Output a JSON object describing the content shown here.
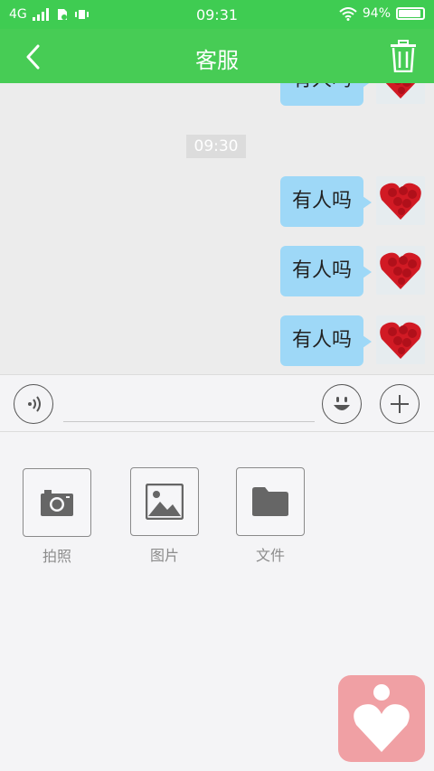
{
  "status_bar": {
    "network": "4G",
    "time": "09:31",
    "battery_percent": "94%",
    "battery_level": 0.94
  },
  "app_bar": {
    "title": "客服"
  },
  "chat": {
    "partial_message": "有人吗",
    "timestamp": "09:30",
    "messages": [
      {
        "text": "有人吗"
      },
      {
        "text": "有人吗"
      },
      {
        "text": "有人吗"
      }
    ]
  },
  "input": {
    "value": "",
    "placeholder": ""
  },
  "attach": {
    "items": [
      {
        "label": "拍照",
        "icon": "camera-icon"
      },
      {
        "label": "图片",
        "icon": "image-icon"
      },
      {
        "label": "文件",
        "icon": "folder-icon"
      }
    ]
  },
  "colors": {
    "primary_green": "#47cc55",
    "bubble_blue": "#9ed8f7",
    "float_pink": "#f0a0a4"
  }
}
